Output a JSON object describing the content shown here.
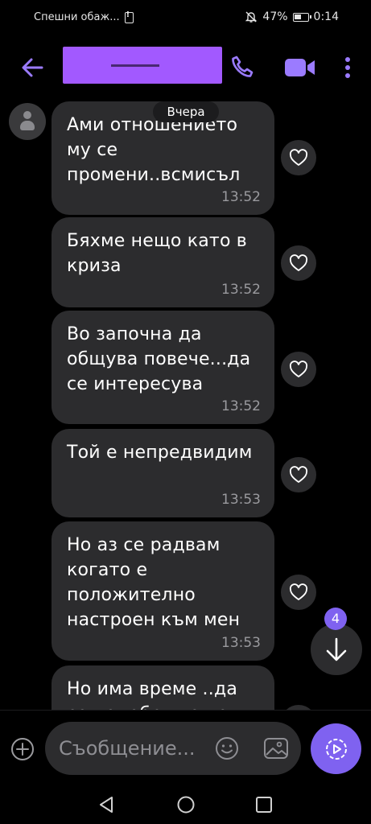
{
  "status_bar": {
    "carrier_text": "Спешни обаж...",
    "battery_percent": "47%",
    "time": "0:14"
  },
  "header": {
    "back_icon": "arrow-left-icon",
    "contact_name_redacted": true,
    "call_icon": "phone-icon",
    "video_icon": "video-camera-icon",
    "more_icon": "more-vertical-icon"
  },
  "chat": {
    "date_separator": "Вчера",
    "messages": [
      {
        "text": "Ами отношението му се промени..всмисъл",
        "time": "13:52"
      },
      {
        "text": "Бяхме нещо като в криза",
        "time": "13:52"
      },
      {
        "text": "Во започна да общува повече...да се интересува",
        "time": "13:52"
      },
      {
        "text": "Той е непредвидим",
        "time": "13:53"
      },
      {
        "text": "Но аз се радвам когато е положително настроен към мен",
        "time": "13:53"
      },
      {
        "text": "Но има време ..да се подобрят още",
        "time": ""
      }
    ],
    "unread_count": "4"
  },
  "input": {
    "placeholder": "Съобщение..."
  },
  "colors": {
    "accent": "#7f62f0",
    "bubble": "#2c2c2e",
    "redaction": "#a259ff",
    "background": "#000000"
  }
}
